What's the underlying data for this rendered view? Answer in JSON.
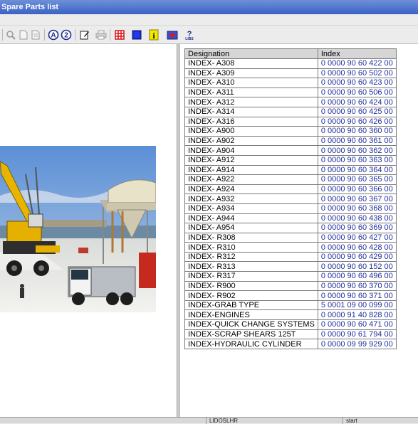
{
  "window": {
    "title": "Spare Parts list"
  },
  "toolbar": {
    "buttons": [
      {
        "icon": "zoom-icon"
      },
      {
        "icon": "page-icon"
      },
      {
        "icon": "page-copy-icon"
      },
      {
        "icon": "circle-a-icon"
      },
      {
        "icon": "circle-2-icon"
      },
      {
        "icon": "edit-icon"
      },
      {
        "icon": "printer-icon"
      },
      {
        "icon": "red-grid-icon"
      },
      {
        "icon": "blue-square-icon"
      },
      {
        "icon": "info-icon"
      },
      {
        "icon": "heart-box-icon"
      },
      {
        "icon": "help-icon"
      }
    ],
    "help_label": "LIBS"
  },
  "table": {
    "headers": [
      "Designation",
      "Index"
    ],
    "rows": [
      [
        "INDEX- A308",
        "0 0000  90 60 422 00"
      ],
      [
        "INDEX- A309",
        "0 0000  90 60 502 00"
      ],
      [
        "INDEX- A310",
        "0 0000  90 60 423 00"
      ],
      [
        "INDEX- A311",
        "0 0000  90 60 506 00"
      ],
      [
        "INDEX- A312",
        "0 0000  90 60 424 00"
      ],
      [
        "INDEX- A314",
        "0 0000  90 60 425 00"
      ],
      [
        "INDEX- A316",
        "0 0000  90 60 426 00"
      ],
      [
        "INDEX- A900",
        "0 0000  90 60 360 00"
      ],
      [
        "INDEX- A902",
        "0 0000  90 60 361 00"
      ],
      [
        "INDEX- A904",
        "0 0000  90 60 362 00"
      ],
      [
        "INDEX- A912",
        "0 0000  90 60 363 00"
      ],
      [
        "INDEX- A914",
        "0 0000  90 60 364 00"
      ],
      [
        "INDEX- A922",
        "0 0000  90 60 365 00"
      ],
      [
        "INDEX- A924",
        "0 0000  90 60 366 00"
      ],
      [
        "INDEX- A932",
        "0 0000  90 60 367 00"
      ],
      [
        "INDEX- A934",
        "0 0000  90 60 368 00"
      ],
      [
        "INDEX- A944",
        "0 0000  90 60 438 00"
      ],
      [
        "INDEX- A954",
        "0 0000  90 60 369 00"
      ],
      [
        "INDEX- R308",
        "0 0000  90 60 427 00"
      ],
      [
        "INDEX- R310",
        "0 0000  90 60 428 00"
      ],
      [
        "INDEX- R312",
        "0 0000  90 60 429 00"
      ],
      [
        "INDEX- R313",
        "0 0000  90 60 152 00"
      ],
      [
        "INDEX- R317",
        "0 0000  90 60 496 00"
      ],
      [
        "INDEX- R900",
        "0 0000  90 60 370 00"
      ],
      [
        "INDEX- R902",
        "0 0000  90 60 371 00"
      ],
      [
        "INDEX-GRAB TYPE",
        "5 0001  09 00 099 00"
      ],
      [
        "INDEX-ENGINES",
        "0 0000  91 40 828 00"
      ],
      [
        "INDEX-QUICK CHANGE SYSTEMS",
        "0 0000  90 60 471 00"
      ],
      [
        "INDEX-SCRAP SHEARS 125T",
        "0 0000  90 61 794 00"
      ],
      [
        "INDEX-HYDRAULIC CYLINDER",
        "0 0000  09 99 929 00"
      ]
    ]
  },
  "statusbar": {
    "user": "LIDOSLHR",
    "state": "start"
  },
  "colors": {
    "title_bar": "#3a62c4",
    "index_text": "#1f2f9e",
    "header_bg": "#d6d6d6"
  }
}
